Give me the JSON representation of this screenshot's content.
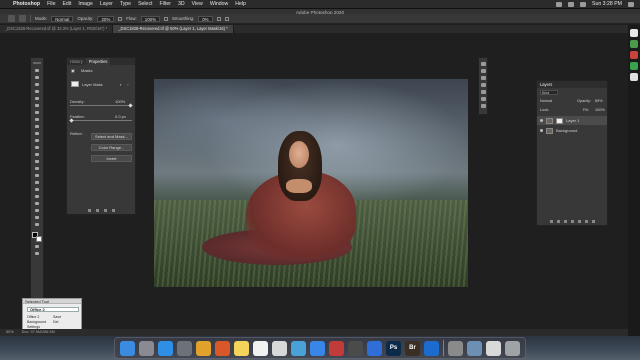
{
  "menubar": {
    "app_name": "Photoshop",
    "items": [
      "File",
      "Edit",
      "Image",
      "Layer",
      "Type",
      "Select",
      "Filter",
      "3D",
      "View",
      "Window",
      "Help"
    ],
    "clock": "Sun 3:28 PM"
  },
  "window": {
    "title": "Adobe Photoshop 2020"
  },
  "options_bar": {
    "mode_label": "Mode:",
    "mode_value": "Normal",
    "opacity_label": "Opacity:",
    "opacity_value": "20%",
    "flow_label": "Flow:",
    "flow_value": "100%",
    "smoothing_label": "Smoothing:",
    "smoothing_value": "0%"
  },
  "tabs": [
    {
      "label": "_DSC1828-Recovered.tif @ 33.3% (Layer 1, RGB/16*) *",
      "active": false
    },
    {
      "label": "_DSC1828-Recovered.tif @ 50% (Layer 1, Layer Mask/16) *",
      "active": true
    }
  ],
  "properties": {
    "tabs": [
      "History",
      "Properties"
    ],
    "masks_label": "Masks",
    "layer_mask_label": "Layer Mask",
    "density_label": "Density:",
    "density_value": "100%",
    "feather_label": "Feather:",
    "feather_value": "0.0 px",
    "refine_label": "Refine:",
    "select_mask_btn": "Select and Mask...",
    "color_range_btn": "Color Range...",
    "invert_btn": "Invert"
  },
  "layers": {
    "title": "Layers",
    "kind_label": "Kind",
    "blend_mode": "Normal",
    "opacity_label": "Opacity:",
    "opacity_value": "89%",
    "lock_label": "Lock:",
    "fill_label": "Fill:",
    "fill_value": "100%",
    "items": [
      {
        "name": "Layer 1",
        "selected": true,
        "has_mask": true
      },
      {
        "name": "Background",
        "selected": false,
        "has_mask": false
      }
    ]
  },
  "dialog": {
    "title": "Selected Tool",
    "selected": "Office 2",
    "items": [
      {
        "left": "Office 2",
        "right": "Save"
      },
      {
        "left": "Background",
        "right": "Del"
      },
      {
        "left": "Settings",
        "right": ""
      }
    ]
  },
  "status": {
    "zoom": "50%",
    "doc": "Doc: 97.5M/286.5M"
  },
  "dock_apps": [
    {
      "name": "finder-icon",
      "color": "#3b8be0",
      "glyph": ""
    },
    {
      "name": "launchpad-icon",
      "color": "#8a8a92",
      "glyph": ""
    },
    {
      "name": "safari-icon",
      "color": "#2f8fe4",
      "glyph": ""
    },
    {
      "name": "system-preferences-icon",
      "color": "#6d7278",
      "glyph": ""
    },
    {
      "name": "chrome-icon",
      "color": "#e0a22b",
      "glyph": ""
    },
    {
      "name": "firefox-icon",
      "color": "#d8582a",
      "glyph": ""
    },
    {
      "name": "notes-icon",
      "color": "#f3d35a",
      "glyph": ""
    },
    {
      "name": "calendar-icon",
      "color": "#f2f2f2",
      "glyph": ""
    },
    {
      "name": "textedit-icon",
      "color": "#d8d8d8",
      "glyph": ""
    },
    {
      "name": "utility-icon",
      "color": "#4aa1d8",
      "glyph": ""
    },
    {
      "name": "app-store-icon",
      "color": "#3a86e8",
      "glyph": ""
    },
    {
      "name": "photo-booth-icon",
      "color": "#c23b3b",
      "glyph": ""
    },
    {
      "name": "quicktime-icon",
      "color": "#4b4b4b",
      "glyph": ""
    },
    {
      "name": "bluetooth-icon",
      "color": "#2f6ed6",
      "glyph": ""
    },
    {
      "name": "photoshop-icon",
      "color": "#0c2a4a",
      "glyph": "Ps"
    },
    {
      "name": "bridge-icon",
      "color": "#3a2f22",
      "glyph": "Br"
    },
    {
      "name": "outlook-icon",
      "color": "#1c6cd0",
      "glyph": ""
    },
    {
      "name": "adobe-cc-icon",
      "color": "#8a8a8a",
      "glyph": ""
    },
    {
      "name": "downloads-icon",
      "color": "#6c8fb3",
      "glyph": ""
    },
    {
      "name": "preview-icon",
      "color": "#d9d9d9",
      "glyph": ""
    },
    {
      "name": "trash-icon",
      "color": "#9ea3a8",
      "glyph": ""
    }
  ]
}
